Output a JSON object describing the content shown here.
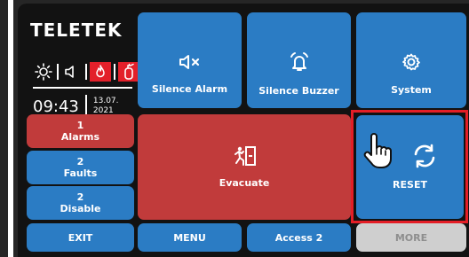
{
  "brand": "TELETEK",
  "status_icons": [
    "sun-icon",
    "speaker-icon",
    "fire-icon",
    "extinguisher-icon"
  ],
  "time": "09:43",
  "date_line1": "13.07.",
  "date_line2": "2021",
  "colors": {
    "blue": "#2b7cc4",
    "red": "#c13b3b",
    "grey": "#cfcfcf",
    "highlight": "#e41e26"
  },
  "top_buttons": {
    "silence_alarm": "Silence Alarm",
    "silence_buzzer": "Silence Buzzer",
    "system": "System"
  },
  "left_buttons": {
    "alarms_count": "1",
    "alarms_label": "Alarms",
    "faults_count": "2",
    "faults_label": "Faults",
    "disable_count": "2",
    "disable_label": "Disable"
  },
  "evacuate": "Evacuate",
  "reset": "RESET",
  "bottom_buttons": {
    "exit": "EXIT",
    "menu": "MENU",
    "access": "Access 2",
    "more": "MORE"
  }
}
